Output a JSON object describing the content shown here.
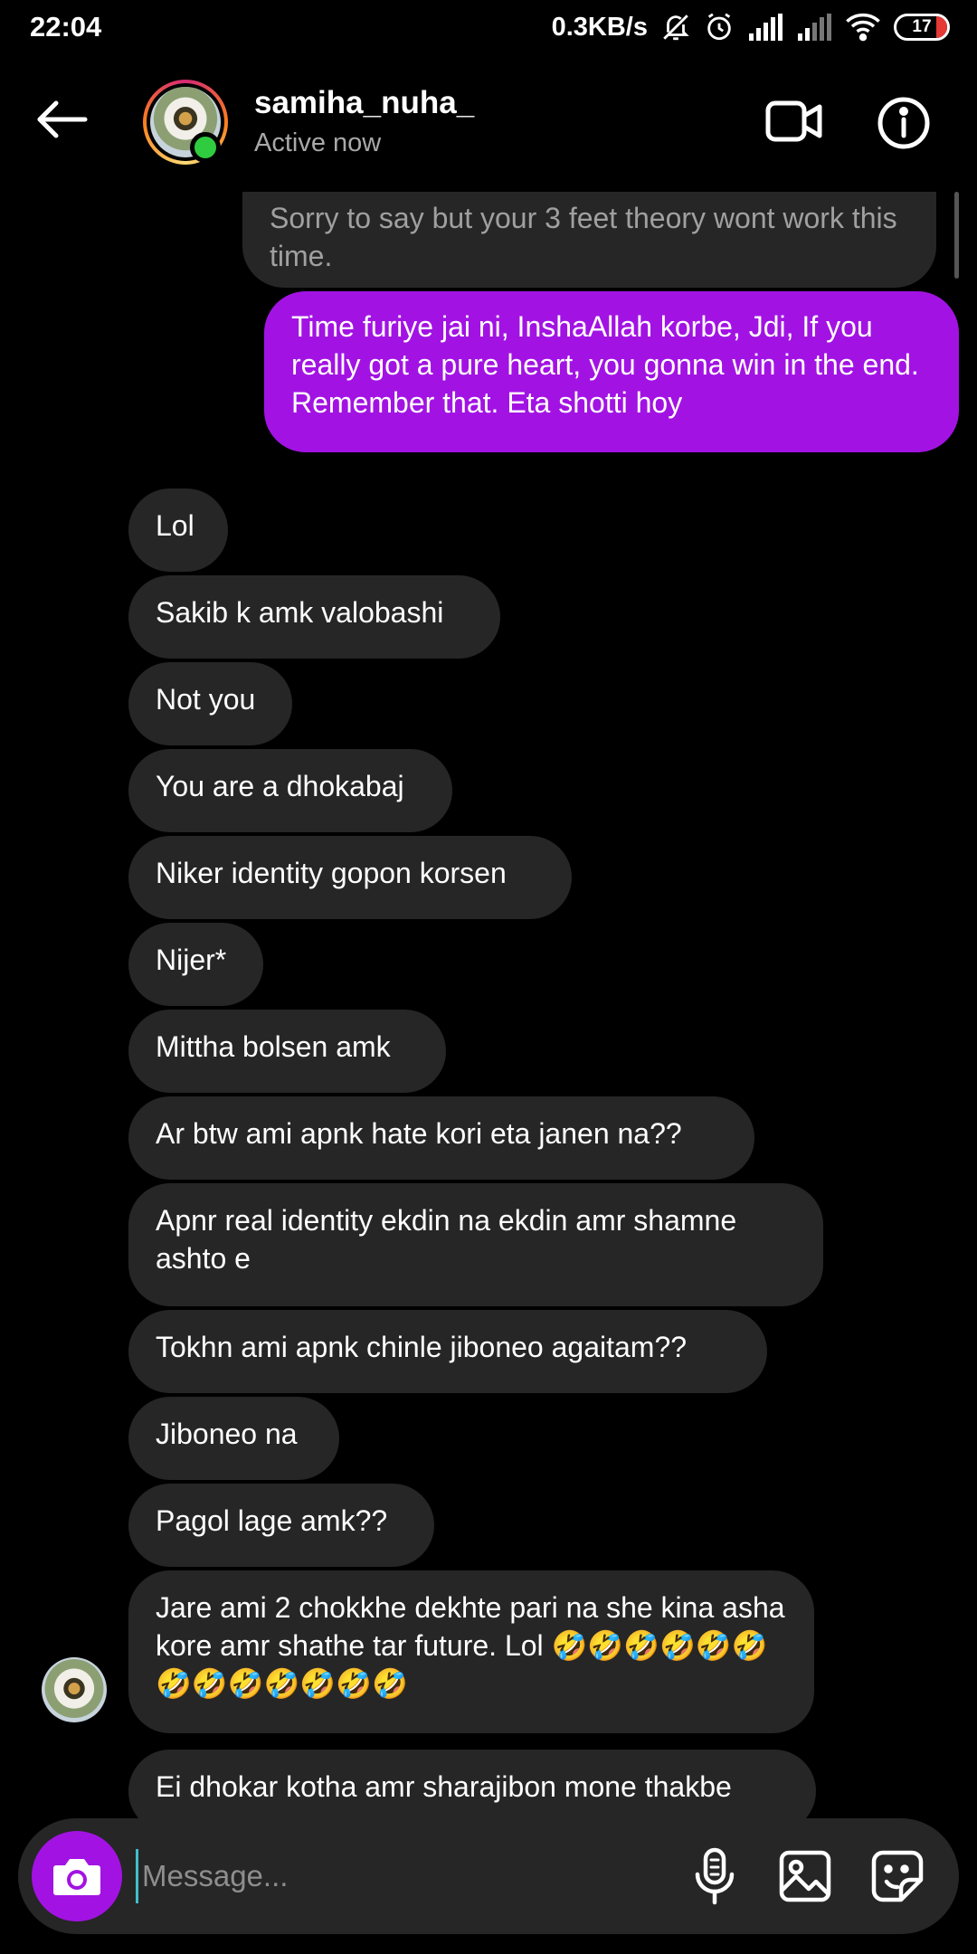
{
  "status_bar": {
    "time": "22:04",
    "net_speed": "0.3KB/s",
    "battery": "17",
    "icons": [
      "mute-icon",
      "alarm-icon",
      "signal-icon",
      "signal-icon",
      "wifi-icon",
      "battery-icon"
    ]
  },
  "header": {
    "username": "samiha_nuha_",
    "status": "Active now",
    "icons": [
      "back-arrow-icon",
      "video-call-icon",
      "info-icon"
    ]
  },
  "messages": [
    {
      "from": "them",
      "type": "reply-quote",
      "text": "Sorry to say but your 3 feet theory wont work this time."
    },
    {
      "from": "me",
      "text": "Time furiye jai ni, InshaAllah korbe, Jdi, If you really got a pure heart, you gonna win in the end. Remember that. Eta shotti hoy"
    },
    {
      "from": "them",
      "text": "Lol"
    },
    {
      "from": "them",
      "text": "Sakib k amk valobashi"
    },
    {
      "from": "them",
      "text": "Not you"
    },
    {
      "from": "them",
      "text": "You are a dhokabaj"
    },
    {
      "from": "them",
      "text": "Niker identity gopon korsen"
    },
    {
      "from": "them",
      "text": "Nijer*"
    },
    {
      "from": "them",
      "text": "Mittha bolsen amk"
    },
    {
      "from": "them",
      "text": "Ar btw ami apnk hate kori eta janen na??"
    },
    {
      "from": "them",
      "text": "Apnr real identity ekdin na ekdin amr shamne ashto e"
    },
    {
      "from": "them",
      "text": "Tokhn ami apnk chinle jiboneo agaitam??"
    },
    {
      "from": "them",
      "text": "Jiboneo na"
    },
    {
      "from": "them",
      "text": "Pagol lage amk??"
    },
    {
      "from": "them",
      "text": "Jare ami 2 chokkhe dekhte pari na she kina asha kore amr shathe tar future. Lol 🤣🤣🤣🤣🤣🤣🤣🤣🤣🤣🤣🤣🤣"
    },
    {
      "from": "them",
      "text": "Ei dhokar kotha amr sharajibon mone thakbe"
    }
  ],
  "composer": {
    "placeholder": "Message...",
    "icons": [
      "camera-icon",
      "microphone-icon",
      "gallery-icon",
      "sticker-icon"
    ]
  },
  "colors": {
    "background": "#000000",
    "incoming_bubble": "#262626",
    "outgoing_bubble": "#a213e3",
    "online": "#2fcc40",
    "camera_button": "#a213e3"
  }
}
